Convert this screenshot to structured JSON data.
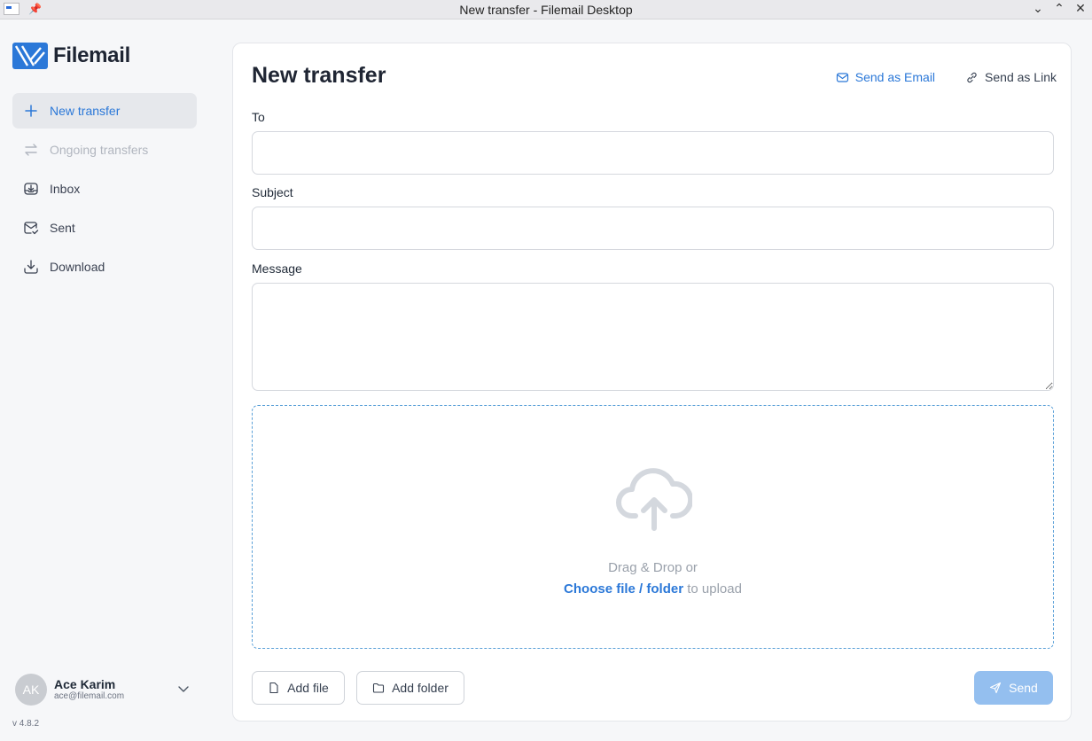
{
  "window": {
    "title": "New transfer - Filemail Desktop",
    "controls": [
      "chevron-down-icon",
      "chevron-up-icon",
      "close-icon"
    ]
  },
  "sidebar": {
    "logo_text": "Filemail",
    "items": [
      {
        "label": "New transfer",
        "icon": "plus-icon",
        "state": "active"
      },
      {
        "label": "Ongoing transfers",
        "icon": "transfer-arrows-icon",
        "state": "disabled"
      },
      {
        "label": "Inbox",
        "icon": "inbox-icon",
        "state": "normal"
      },
      {
        "label": "Sent",
        "icon": "sent-mail-icon",
        "state": "normal"
      },
      {
        "label": "Download",
        "icon": "download-icon",
        "state": "normal"
      }
    ],
    "user": {
      "initials": "AK",
      "name": "Ace Karim",
      "email": "ace@filemail.com"
    },
    "version": "v 4.8.2"
  },
  "main": {
    "title": "New transfer",
    "mode_tabs": [
      {
        "label": "Send as Email",
        "icon": "envelope-icon",
        "active": true
      },
      {
        "label": "Send as Link",
        "icon": "link-icon",
        "active": false
      }
    ],
    "fields": {
      "to": {
        "label": "To",
        "value": ""
      },
      "subject": {
        "label": "Subject",
        "value": ""
      },
      "message": {
        "label": "Message",
        "value": ""
      }
    },
    "dropzone": {
      "line1": "Drag & Drop or",
      "link": "Choose file / folder",
      "suffix": " to upload",
      "icon": "cloud-upload-icon"
    },
    "buttons": {
      "add_file": "Add file",
      "add_folder": "Add folder",
      "send": "Send"
    }
  },
  "colors": {
    "accent": "#2b78d8",
    "send_disabled": "#94bfef",
    "dropzone_border": "#5aa0d8"
  }
}
